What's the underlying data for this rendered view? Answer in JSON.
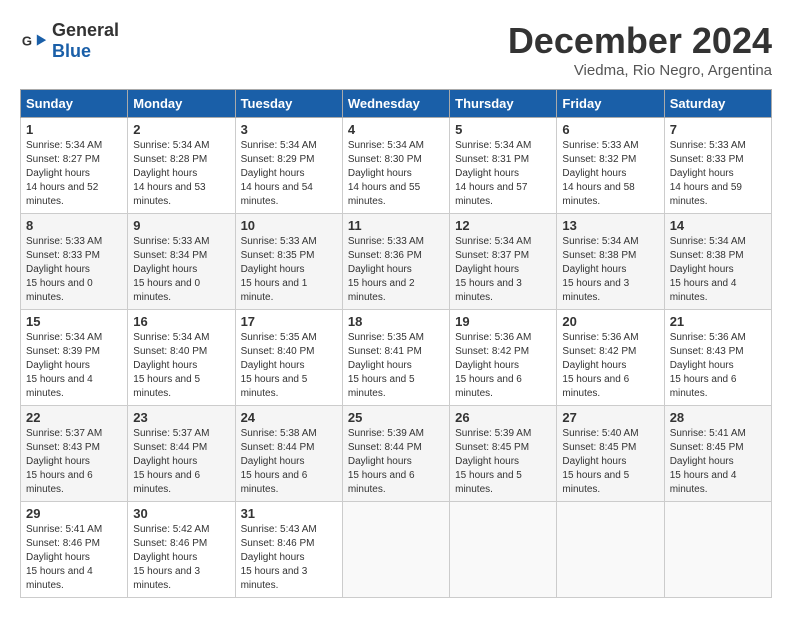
{
  "logo": {
    "general": "General",
    "blue": "Blue"
  },
  "title": "December 2024",
  "location": "Viedma, Rio Negro, Argentina",
  "days_of_week": [
    "Sunday",
    "Monday",
    "Tuesday",
    "Wednesday",
    "Thursday",
    "Friday",
    "Saturday"
  ],
  "weeks": [
    [
      {
        "day": "1",
        "sunrise": "5:34 AM",
        "sunset": "8:27 PM",
        "daylight": "14 hours and 52 minutes."
      },
      {
        "day": "2",
        "sunrise": "5:34 AM",
        "sunset": "8:28 PM",
        "daylight": "14 hours and 53 minutes."
      },
      {
        "day": "3",
        "sunrise": "5:34 AM",
        "sunset": "8:29 PM",
        "daylight": "14 hours and 54 minutes."
      },
      {
        "day": "4",
        "sunrise": "5:34 AM",
        "sunset": "8:30 PM",
        "daylight": "14 hours and 55 minutes."
      },
      {
        "day": "5",
        "sunrise": "5:34 AM",
        "sunset": "8:31 PM",
        "daylight": "14 hours and 57 minutes."
      },
      {
        "day": "6",
        "sunrise": "5:33 AM",
        "sunset": "8:32 PM",
        "daylight": "14 hours and 58 minutes."
      },
      {
        "day": "7",
        "sunrise": "5:33 AM",
        "sunset": "8:33 PM",
        "daylight": "14 hours and 59 minutes."
      }
    ],
    [
      {
        "day": "8",
        "sunrise": "5:33 AM",
        "sunset": "8:33 PM",
        "daylight": "15 hours and 0 minutes."
      },
      {
        "day": "9",
        "sunrise": "5:33 AM",
        "sunset": "8:34 PM",
        "daylight": "15 hours and 0 minutes."
      },
      {
        "day": "10",
        "sunrise": "5:33 AM",
        "sunset": "8:35 PM",
        "daylight": "15 hours and 1 minute."
      },
      {
        "day": "11",
        "sunrise": "5:33 AM",
        "sunset": "8:36 PM",
        "daylight": "15 hours and 2 minutes."
      },
      {
        "day": "12",
        "sunrise": "5:34 AM",
        "sunset": "8:37 PM",
        "daylight": "15 hours and 3 minutes."
      },
      {
        "day": "13",
        "sunrise": "5:34 AM",
        "sunset": "8:38 PM",
        "daylight": "15 hours and 3 minutes."
      },
      {
        "day": "14",
        "sunrise": "5:34 AM",
        "sunset": "8:38 PM",
        "daylight": "15 hours and 4 minutes."
      }
    ],
    [
      {
        "day": "15",
        "sunrise": "5:34 AM",
        "sunset": "8:39 PM",
        "daylight": "15 hours and 4 minutes."
      },
      {
        "day": "16",
        "sunrise": "5:34 AM",
        "sunset": "8:40 PM",
        "daylight": "15 hours and 5 minutes."
      },
      {
        "day": "17",
        "sunrise": "5:35 AM",
        "sunset": "8:40 PM",
        "daylight": "15 hours and 5 minutes."
      },
      {
        "day": "18",
        "sunrise": "5:35 AM",
        "sunset": "8:41 PM",
        "daylight": "15 hours and 5 minutes."
      },
      {
        "day": "19",
        "sunrise": "5:36 AM",
        "sunset": "8:42 PM",
        "daylight": "15 hours and 6 minutes."
      },
      {
        "day": "20",
        "sunrise": "5:36 AM",
        "sunset": "8:42 PM",
        "daylight": "15 hours and 6 minutes."
      },
      {
        "day": "21",
        "sunrise": "5:36 AM",
        "sunset": "8:43 PM",
        "daylight": "15 hours and 6 minutes."
      }
    ],
    [
      {
        "day": "22",
        "sunrise": "5:37 AM",
        "sunset": "8:43 PM",
        "daylight": "15 hours and 6 minutes."
      },
      {
        "day": "23",
        "sunrise": "5:37 AM",
        "sunset": "8:44 PM",
        "daylight": "15 hours and 6 minutes."
      },
      {
        "day": "24",
        "sunrise": "5:38 AM",
        "sunset": "8:44 PM",
        "daylight": "15 hours and 6 minutes."
      },
      {
        "day": "25",
        "sunrise": "5:39 AM",
        "sunset": "8:44 PM",
        "daylight": "15 hours and 6 minutes."
      },
      {
        "day": "26",
        "sunrise": "5:39 AM",
        "sunset": "8:45 PM",
        "daylight": "15 hours and 5 minutes."
      },
      {
        "day": "27",
        "sunrise": "5:40 AM",
        "sunset": "8:45 PM",
        "daylight": "15 hours and 5 minutes."
      },
      {
        "day": "28",
        "sunrise": "5:41 AM",
        "sunset": "8:45 PM",
        "daylight": "15 hours and 4 minutes."
      }
    ],
    [
      {
        "day": "29",
        "sunrise": "5:41 AM",
        "sunset": "8:46 PM",
        "daylight": "15 hours and 4 minutes."
      },
      {
        "day": "30",
        "sunrise": "5:42 AM",
        "sunset": "8:46 PM",
        "daylight": "15 hours and 3 minutes."
      },
      {
        "day": "31",
        "sunrise": "5:43 AM",
        "sunset": "8:46 PM",
        "daylight": "15 hours and 3 minutes."
      },
      null,
      null,
      null,
      null
    ]
  ],
  "labels": {
    "sunrise": "Sunrise:",
    "sunset": "Sunset:",
    "daylight": "Daylight hours"
  }
}
